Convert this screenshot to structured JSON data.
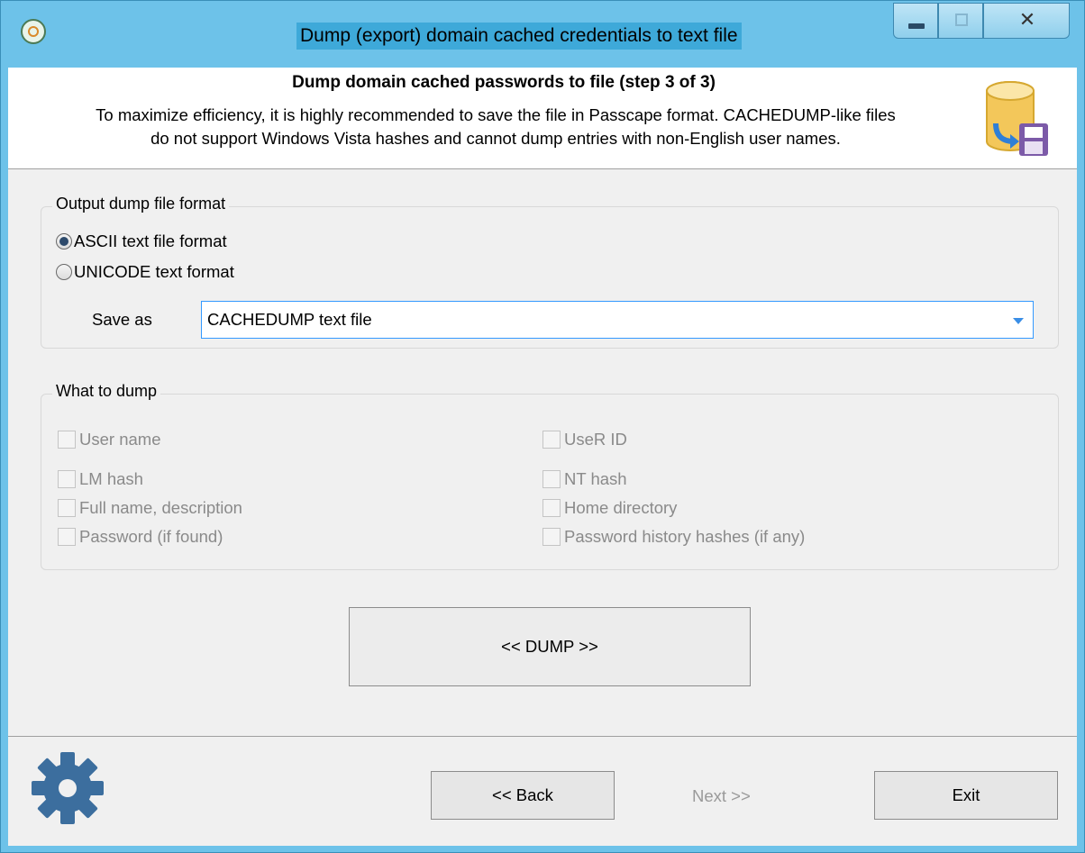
{
  "window": {
    "title": "Dump (export) domain cached credentials to text file",
    "close_glyph": "✕"
  },
  "header": {
    "title": "Dump domain cached passwords to file (step 3 of 3)",
    "desc_line1": "To maximize efficiency, it is highly recommended to save the file in Passcape format. CACHEDUMP-like files",
    "desc_line2": "do not support Windows Vista hashes and cannot dump entries with non-English user names.",
    "icon": "database-save-icon"
  },
  "output_format": {
    "group_title": "Output dump file format",
    "options": [
      {
        "label": "ASCII text file format",
        "selected": true
      },
      {
        "label": "UNICODE text format",
        "selected": false
      }
    ],
    "save_as_label": "Save as",
    "save_as_value": "CACHEDUMP text file"
  },
  "what_to_dump": {
    "group_title": "What to dump",
    "left": [
      "User name",
      "LM hash",
      "Full name, description",
      "Password (if found)"
    ],
    "right": [
      "UseR ID",
      "NT hash",
      "Home directory",
      "Password history hashes (if any)"
    ]
  },
  "buttons": {
    "dump": "<< DUMP >>",
    "back": "<< Back",
    "next": "Next >>",
    "exit": "Exit"
  },
  "colors": {
    "title_bar": "#6dc2e9",
    "client_bg": "#f0f0f0",
    "gear": "#3c6e9e"
  }
}
